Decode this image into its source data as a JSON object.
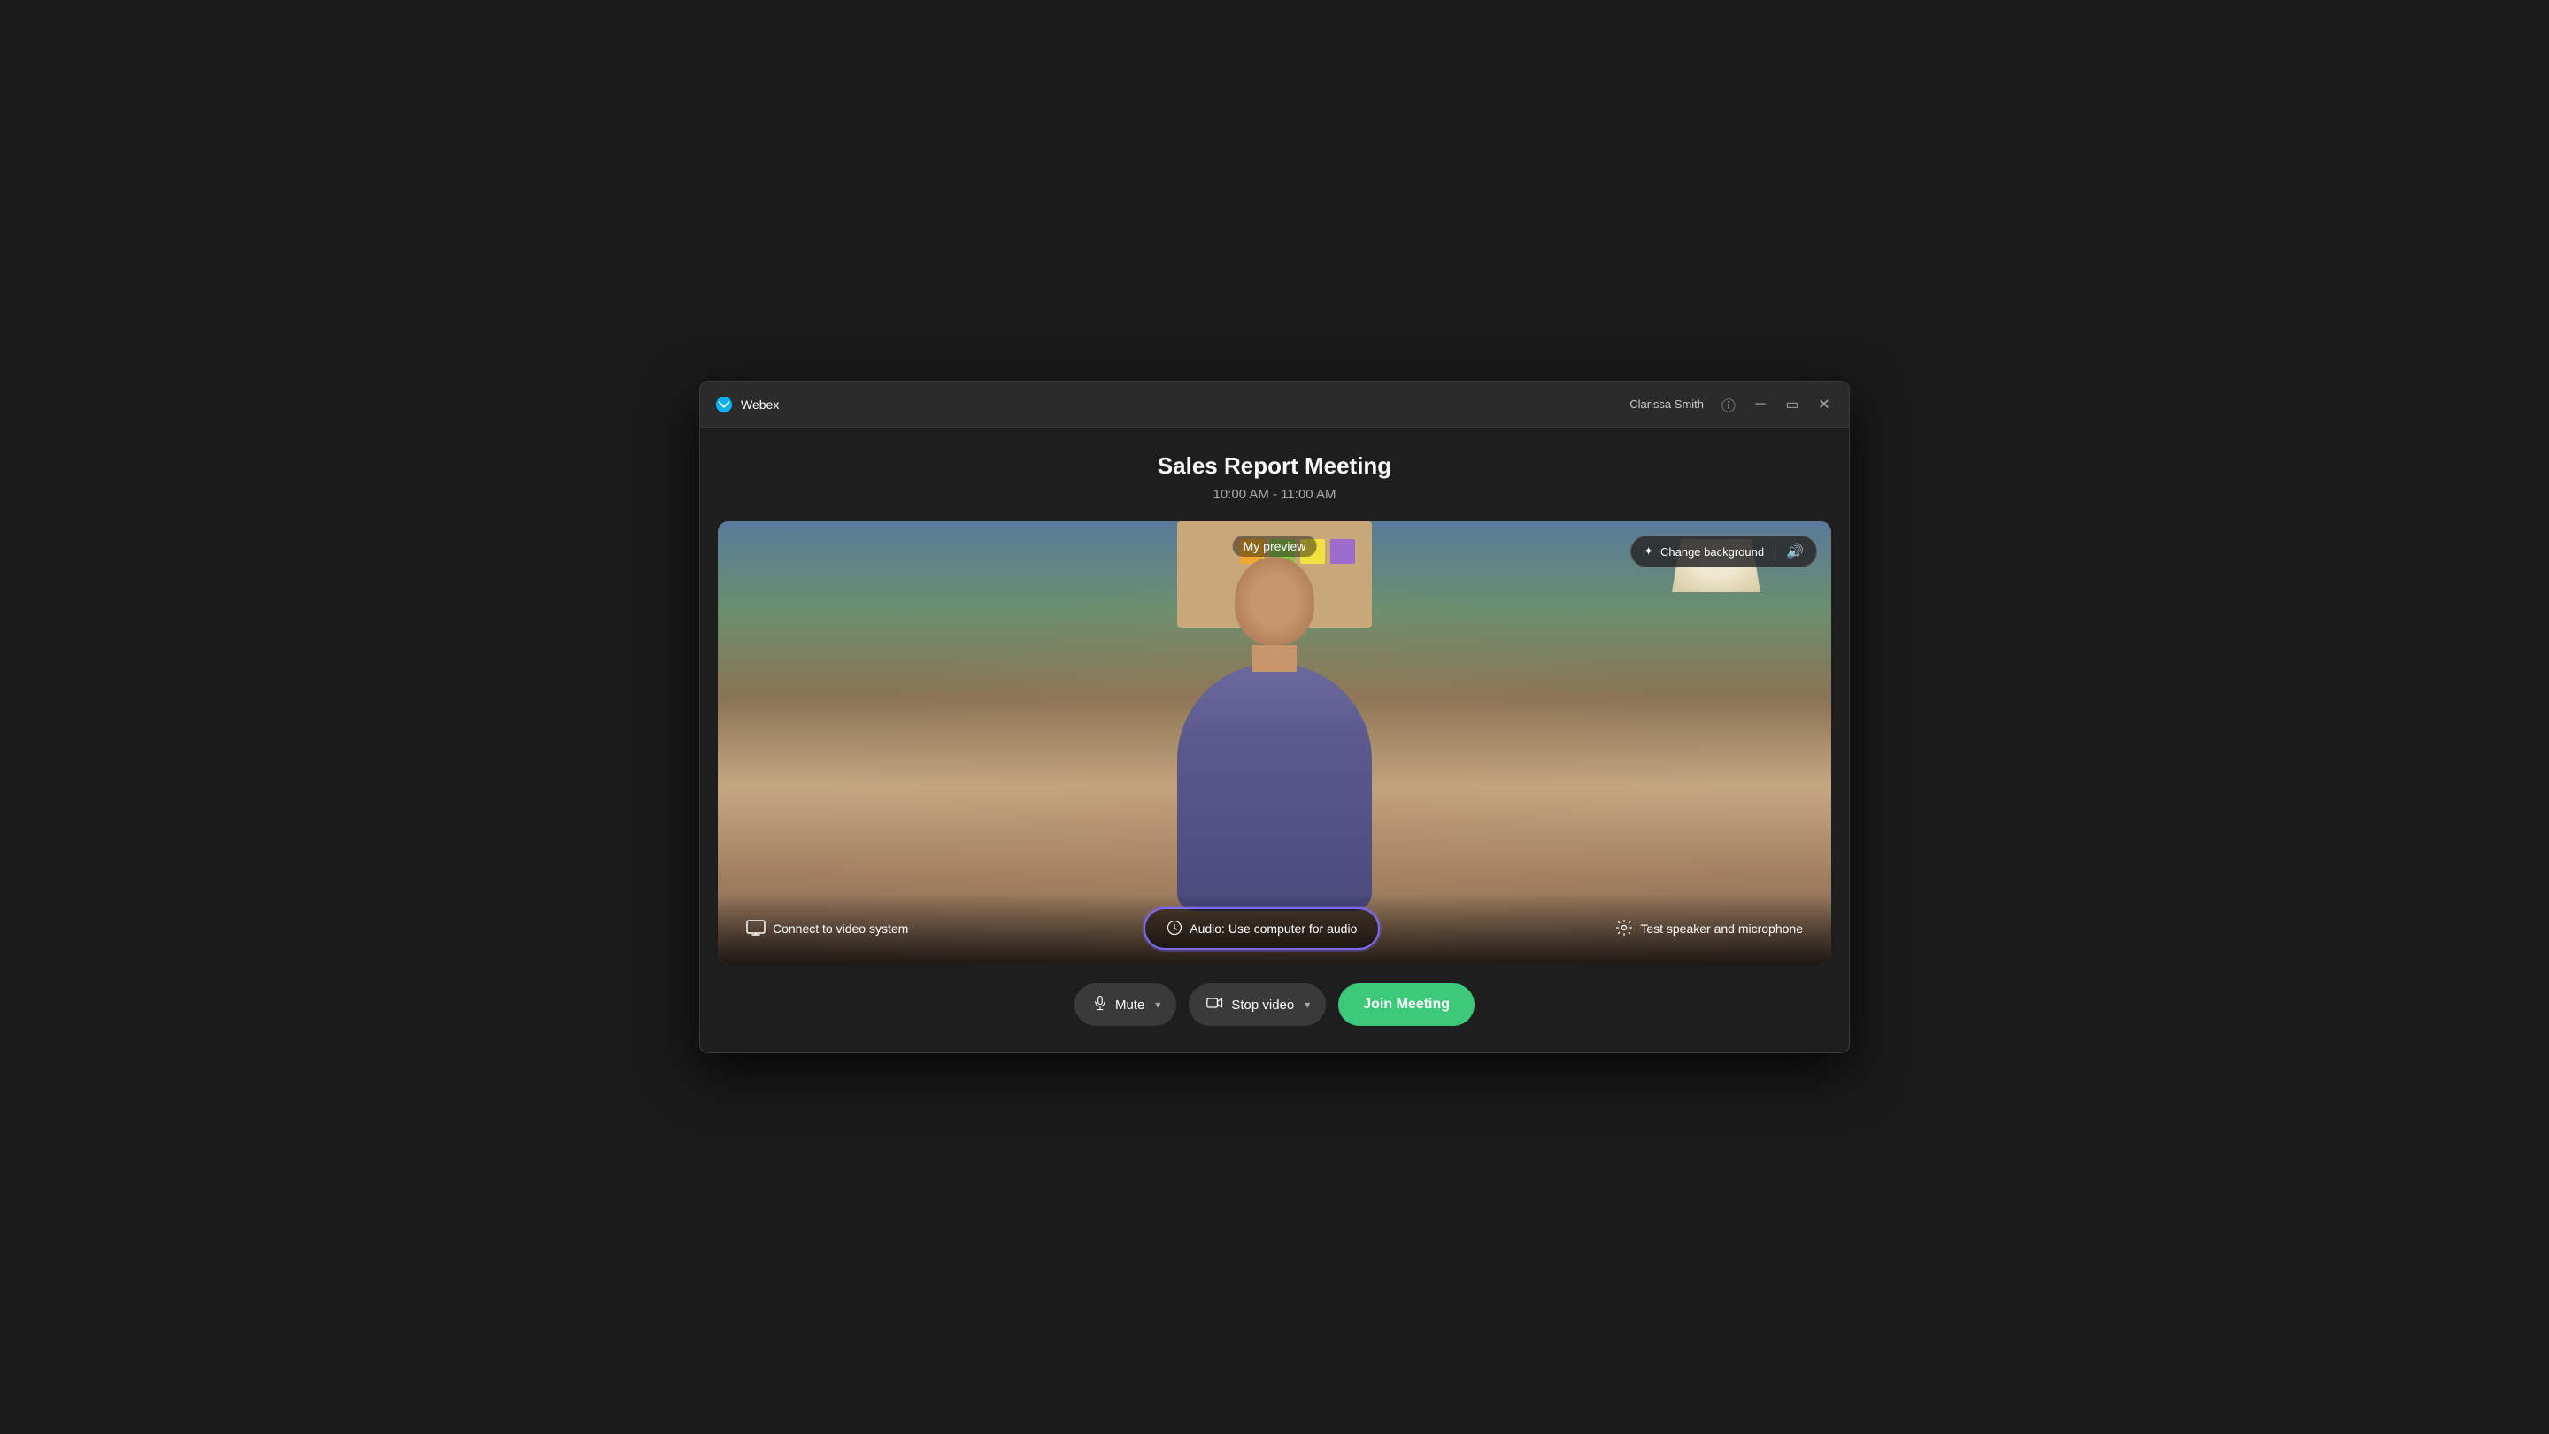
{
  "titlebar": {
    "logo_text": "Webex",
    "user_name": "Clarissa Smith"
  },
  "meeting": {
    "title": "Sales Report Meeting",
    "time": "10:00 AM - 11:00 AM"
  },
  "preview": {
    "label": "My preview"
  },
  "buttons": {
    "change_background": "Change background",
    "connect_video": "Connect to video system",
    "audio": "Audio: Use computer for audio",
    "test_speaker": "Test speaker and microphone",
    "mute": "Mute",
    "stop_video": "Stop video",
    "join_meeting": "Join Meeting"
  },
  "sticky_colors": [
    "#f0a830",
    "#8bc34a",
    "#f0e040",
    "#9c6bcc"
  ],
  "colors": {
    "accent_green": "#3dc97a",
    "accent_purple": "#7c6bf0"
  }
}
